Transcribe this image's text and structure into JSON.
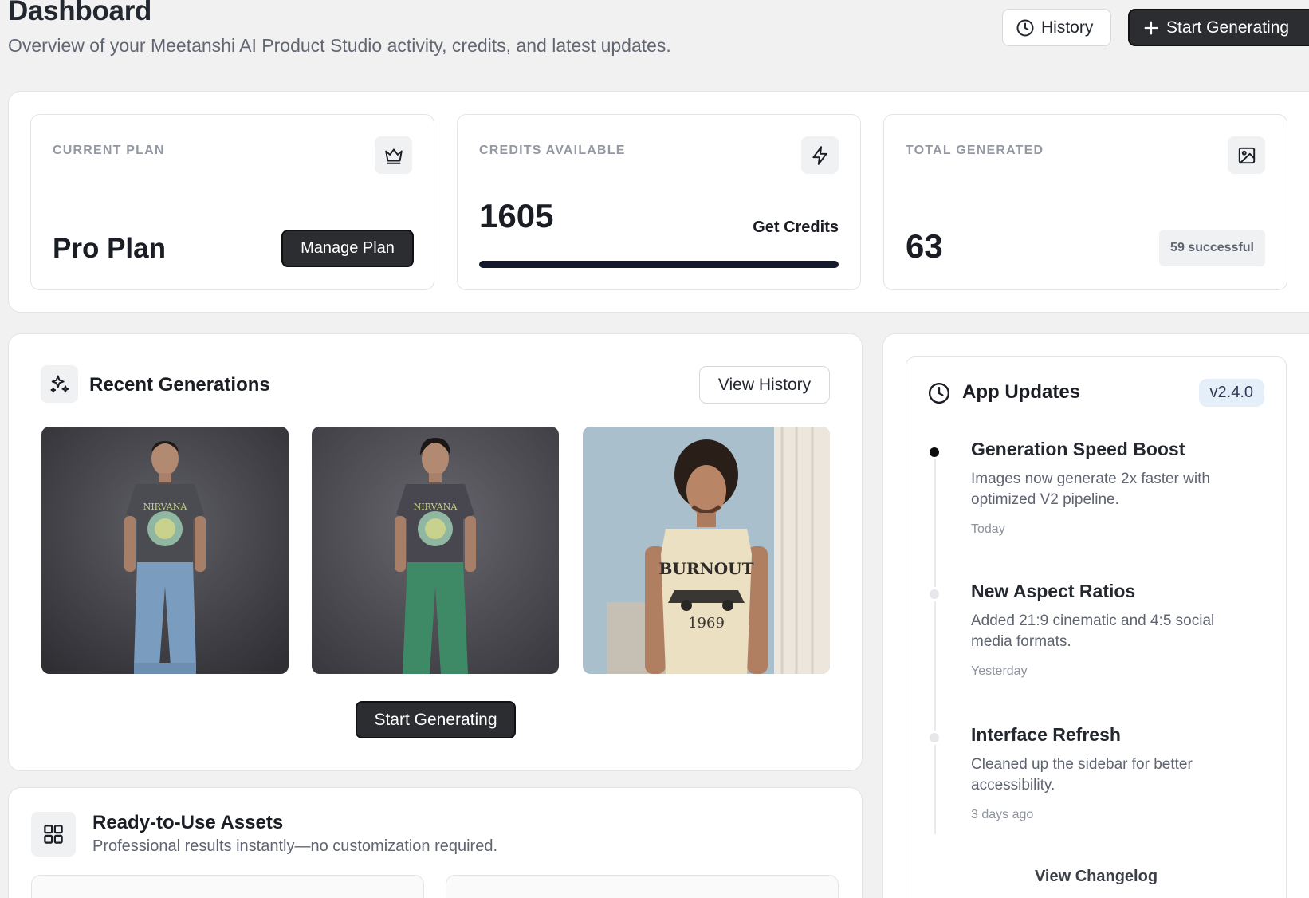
{
  "header": {
    "title": "Dashboard",
    "subtitle": "Overview of your Meetanshi AI Product Studio activity, credits, and latest updates.",
    "history_label": "History",
    "start_label": "Start Generating"
  },
  "stats": {
    "plan": {
      "label": "CURRENT PLAN",
      "value": "Pro Plan",
      "button": "Manage Plan",
      "icon": "crown-icon"
    },
    "credits": {
      "label": "CREDITS AVAILABLE",
      "value": "1605",
      "link": "Get Credits",
      "progress_percent": 100,
      "icon": "lightning-icon"
    },
    "total": {
      "label": "TOTAL GENERATED",
      "value": "63",
      "badge": "59 successful",
      "icon": "image-icon"
    }
  },
  "recent": {
    "title": "Recent Generations",
    "view_history": "View History",
    "start_button": "Start Generating",
    "icon": "sparkles-icon"
  },
  "assets": {
    "title": "Ready-to-Use Assets",
    "subtitle": "Professional results instantly—no customization required.",
    "icon": "grid-icon"
  },
  "updates": {
    "title": "App Updates",
    "version": "v2.4.0",
    "icon": "clock-icon",
    "items": [
      {
        "title": "Generation Speed Boost",
        "desc": "Images now generate 2x faster with optimized V2 pipeline.",
        "time": "Today"
      },
      {
        "title": "New Aspect Ratios",
        "desc": "Added 21:9 cinematic and 4:5 social media formats.",
        "time": "Yesterday"
      },
      {
        "title": "Interface Refresh",
        "desc": "Cleaned up the sidebar for better accessibility.",
        "time": "3 days ago"
      }
    ],
    "changelog": "View Changelog"
  },
  "colors": {
    "accent_dark": "#2c2d30",
    "progress": "#141a2b",
    "version_badge_bg": "#e4eff9"
  }
}
